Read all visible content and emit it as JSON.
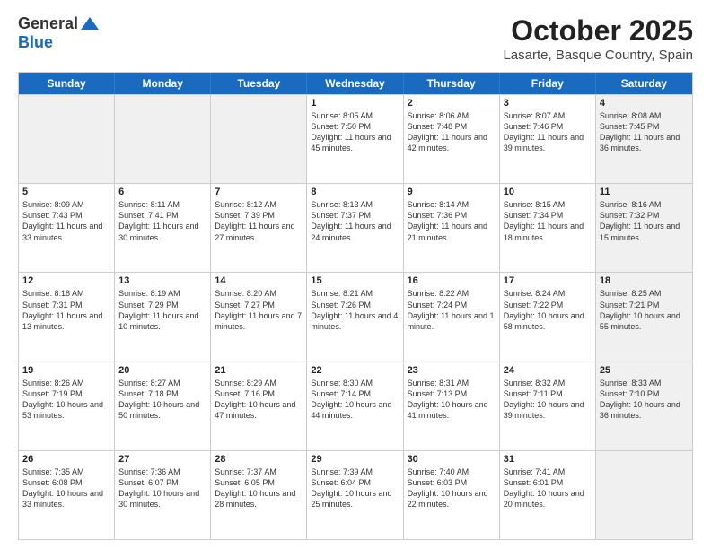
{
  "logo": {
    "general": "General",
    "blue": "Blue"
  },
  "title": "October 2025",
  "location": "Lasarte, Basque Country, Spain",
  "header_days": [
    "Sunday",
    "Monday",
    "Tuesday",
    "Wednesday",
    "Thursday",
    "Friday",
    "Saturday"
  ],
  "rows": [
    [
      {
        "day": "",
        "info": "",
        "shaded": true,
        "empty": true
      },
      {
        "day": "",
        "info": "",
        "shaded": true,
        "empty": true
      },
      {
        "day": "",
        "info": "",
        "shaded": true,
        "empty": true
      },
      {
        "day": "1",
        "info": "Sunrise: 8:05 AM\nSunset: 7:50 PM\nDaylight: 11 hours and 45 minutes."
      },
      {
        "day": "2",
        "info": "Sunrise: 8:06 AM\nSunset: 7:48 PM\nDaylight: 11 hours and 42 minutes."
      },
      {
        "day": "3",
        "info": "Sunrise: 8:07 AM\nSunset: 7:46 PM\nDaylight: 11 hours and 39 minutes."
      },
      {
        "day": "4",
        "info": "Sunrise: 8:08 AM\nSunset: 7:45 PM\nDaylight: 11 hours and 36 minutes.",
        "shaded": true
      }
    ],
    [
      {
        "day": "5",
        "info": "Sunrise: 8:09 AM\nSunset: 7:43 PM\nDaylight: 11 hours and 33 minutes."
      },
      {
        "day": "6",
        "info": "Sunrise: 8:11 AM\nSunset: 7:41 PM\nDaylight: 11 hours and 30 minutes."
      },
      {
        "day": "7",
        "info": "Sunrise: 8:12 AM\nSunset: 7:39 PM\nDaylight: 11 hours and 27 minutes."
      },
      {
        "day": "8",
        "info": "Sunrise: 8:13 AM\nSunset: 7:37 PM\nDaylight: 11 hours and 24 minutes."
      },
      {
        "day": "9",
        "info": "Sunrise: 8:14 AM\nSunset: 7:36 PM\nDaylight: 11 hours and 21 minutes."
      },
      {
        "day": "10",
        "info": "Sunrise: 8:15 AM\nSunset: 7:34 PM\nDaylight: 11 hours and 18 minutes."
      },
      {
        "day": "11",
        "info": "Sunrise: 8:16 AM\nSunset: 7:32 PM\nDaylight: 11 hours and 15 minutes.",
        "shaded": true
      }
    ],
    [
      {
        "day": "12",
        "info": "Sunrise: 8:18 AM\nSunset: 7:31 PM\nDaylight: 11 hours and 13 minutes."
      },
      {
        "day": "13",
        "info": "Sunrise: 8:19 AM\nSunset: 7:29 PM\nDaylight: 11 hours and 10 minutes."
      },
      {
        "day": "14",
        "info": "Sunrise: 8:20 AM\nSunset: 7:27 PM\nDaylight: 11 hours and 7 minutes."
      },
      {
        "day": "15",
        "info": "Sunrise: 8:21 AM\nSunset: 7:26 PM\nDaylight: 11 hours and 4 minutes."
      },
      {
        "day": "16",
        "info": "Sunrise: 8:22 AM\nSunset: 7:24 PM\nDaylight: 11 hours and 1 minute."
      },
      {
        "day": "17",
        "info": "Sunrise: 8:24 AM\nSunset: 7:22 PM\nDaylight: 10 hours and 58 minutes."
      },
      {
        "day": "18",
        "info": "Sunrise: 8:25 AM\nSunset: 7:21 PM\nDaylight: 10 hours and 55 minutes.",
        "shaded": true
      }
    ],
    [
      {
        "day": "19",
        "info": "Sunrise: 8:26 AM\nSunset: 7:19 PM\nDaylight: 10 hours and 53 minutes."
      },
      {
        "day": "20",
        "info": "Sunrise: 8:27 AM\nSunset: 7:18 PM\nDaylight: 10 hours and 50 minutes."
      },
      {
        "day": "21",
        "info": "Sunrise: 8:29 AM\nSunset: 7:16 PM\nDaylight: 10 hours and 47 minutes."
      },
      {
        "day": "22",
        "info": "Sunrise: 8:30 AM\nSunset: 7:14 PM\nDaylight: 10 hours and 44 minutes."
      },
      {
        "day": "23",
        "info": "Sunrise: 8:31 AM\nSunset: 7:13 PM\nDaylight: 10 hours and 41 minutes."
      },
      {
        "day": "24",
        "info": "Sunrise: 8:32 AM\nSunset: 7:11 PM\nDaylight: 10 hours and 39 minutes."
      },
      {
        "day": "25",
        "info": "Sunrise: 8:33 AM\nSunset: 7:10 PM\nDaylight: 10 hours and 36 minutes.",
        "shaded": true
      }
    ],
    [
      {
        "day": "26",
        "info": "Sunrise: 7:35 AM\nSunset: 6:08 PM\nDaylight: 10 hours and 33 minutes."
      },
      {
        "day": "27",
        "info": "Sunrise: 7:36 AM\nSunset: 6:07 PM\nDaylight: 10 hours and 30 minutes."
      },
      {
        "day": "28",
        "info": "Sunrise: 7:37 AM\nSunset: 6:05 PM\nDaylight: 10 hours and 28 minutes."
      },
      {
        "day": "29",
        "info": "Sunrise: 7:39 AM\nSunset: 6:04 PM\nDaylight: 10 hours and 25 minutes."
      },
      {
        "day": "30",
        "info": "Sunrise: 7:40 AM\nSunset: 6:03 PM\nDaylight: 10 hours and 22 minutes."
      },
      {
        "day": "31",
        "info": "Sunrise: 7:41 AM\nSunset: 6:01 PM\nDaylight: 10 hours and 20 minutes."
      },
      {
        "day": "",
        "info": "",
        "shaded": true,
        "empty": true
      }
    ]
  ]
}
